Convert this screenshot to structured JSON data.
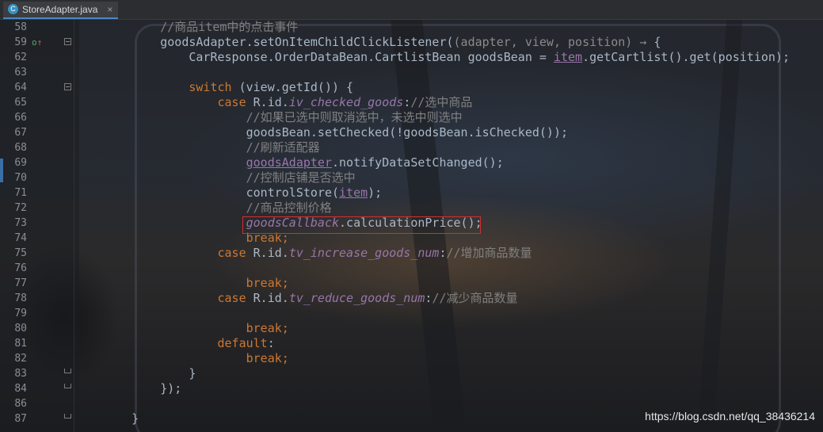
{
  "tab": {
    "file_name": "StoreAdapter.java",
    "icon_letter": "C",
    "close_glyph": "×"
  },
  "lines": [
    {
      "num": "58",
      "segments": [
        [
          "c",
          "        //商品item中的点击事件"
        ]
      ]
    },
    {
      "num": "59",
      "marker": true,
      "fold": true,
      "segments": [
        [
          "p",
          "        goodsAdapter.setOnItemChildClickListener("
        ],
        [
          "hint",
          "(adapter, view, position) → "
        ],
        [
          "p",
          "{"
        ]
      ]
    },
    {
      "num": "62",
      "segments": [
        [
          "p",
          "            CarResponse.OrderDataBean.CartlistBean goodsBean = "
        ],
        [
          "v",
          "item"
        ],
        [
          "p",
          ".getCartlist().get(position);"
        ]
      ]
    },
    {
      "num": "63",
      "segments": [
        [
          "p",
          ""
        ]
      ]
    },
    {
      "num": "64",
      "fold": true,
      "segments": [
        [
          "k",
          "            switch "
        ],
        [
          "p",
          "(view.getId()) {"
        ]
      ]
    },
    {
      "num": "65",
      "segments": [
        [
          "k",
          "                case "
        ],
        [
          "p",
          "R.id."
        ],
        [
          "f",
          "iv_checked_goods"
        ],
        [
          "p",
          ":"
        ],
        [
          "c",
          "//选中商品"
        ]
      ]
    },
    {
      "num": "66",
      "segments": [
        [
          "c",
          "                    //如果已选中则取消选中，未选中则选中"
        ]
      ]
    },
    {
      "num": "67",
      "segments": [
        [
          "p",
          "                    goodsBean.setChecked(!goodsBean.isChecked());"
        ]
      ]
    },
    {
      "num": "68",
      "segments": [
        [
          "c",
          "                    //刷新适配器"
        ]
      ]
    },
    {
      "num": "69",
      "segments": [
        [
          "p",
          "                    "
        ],
        [
          "v",
          "goodsAdapter"
        ],
        [
          "p",
          ".notifyDataSetChanged();"
        ]
      ]
    },
    {
      "num": "70",
      "segments": [
        [
          "c",
          "                    //控制店铺是否选中"
        ]
      ]
    },
    {
      "num": "71",
      "segments": [
        [
          "p",
          "                    controlStore("
        ],
        [
          "v",
          "item"
        ],
        [
          "p",
          ");"
        ]
      ]
    },
    {
      "num": "72",
      "segments": [
        [
          "c",
          "                    //商品控制价格"
        ]
      ]
    },
    {
      "num": "73",
      "segments": [
        [
          "p",
          "                    "
        ],
        [
          "f",
          "goodsCallback"
        ],
        [
          "p",
          ".calculationPrice();"
        ]
      ]
    },
    {
      "num": "74",
      "segments": [
        [
          "k",
          "                    break;"
        ]
      ]
    },
    {
      "num": "75",
      "segments": [
        [
          "k",
          "                case "
        ],
        [
          "p",
          "R.id."
        ],
        [
          "f",
          "tv_increase_goods_num"
        ],
        [
          "p",
          ":"
        ],
        [
          "c",
          "//增加商品数量"
        ]
      ]
    },
    {
      "num": "76",
      "segments": [
        [
          "p",
          ""
        ]
      ]
    },
    {
      "num": "77",
      "segments": [
        [
          "k",
          "                    break;"
        ]
      ]
    },
    {
      "num": "78",
      "segments": [
        [
          "k",
          "                case "
        ],
        [
          "p",
          "R.id."
        ],
        [
          "f",
          "tv_reduce_goods_num"
        ],
        [
          "p",
          ":"
        ],
        [
          "c",
          "//减少商品数量"
        ]
      ]
    },
    {
      "num": "79",
      "segments": [
        [
          "p",
          ""
        ]
      ]
    },
    {
      "num": "80",
      "segments": [
        [
          "k",
          "                    break;"
        ]
      ]
    },
    {
      "num": "81",
      "segments": [
        [
          "k",
          "                default"
        ],
        [
          "p",
          ":"
        ]
      ]
    },
    {
      "num": "82",
      "segments": [
        [
          "k",
          "                    break;"
        ]
      ]
    },
    {
      "num": "83",
      "fold_end": true,
      "segments": [
        [
          "p",
          "            }"
        ]
      ]
    },
    {
      "num": "84",
      "fold_end": true,
      "segments": [
        [
          "p",
          "        });"
        ]
      ]
    },
    {
      "num": "86",
      "segments": [
        [
          "p",
          ""
        ]
      ]
    },
    {
      "num": "87",
      "fold_end": true,
      "segments": [
        [
          "p",
          "    }"
        ]
      ]
    }
  ],
  "highlight_line": "73",
  "marker_glyph": "o↑",
  "watermark": "https://blog.csdn.net/qq_38436214",
  "colors": {
    "keyword": "#cc7832",
    "comment": "#808080",
    "field": "#9876aa",
    "highlight_box": "#d22f2f",
    "tab_underline": "#4a88c7"
  }
}
